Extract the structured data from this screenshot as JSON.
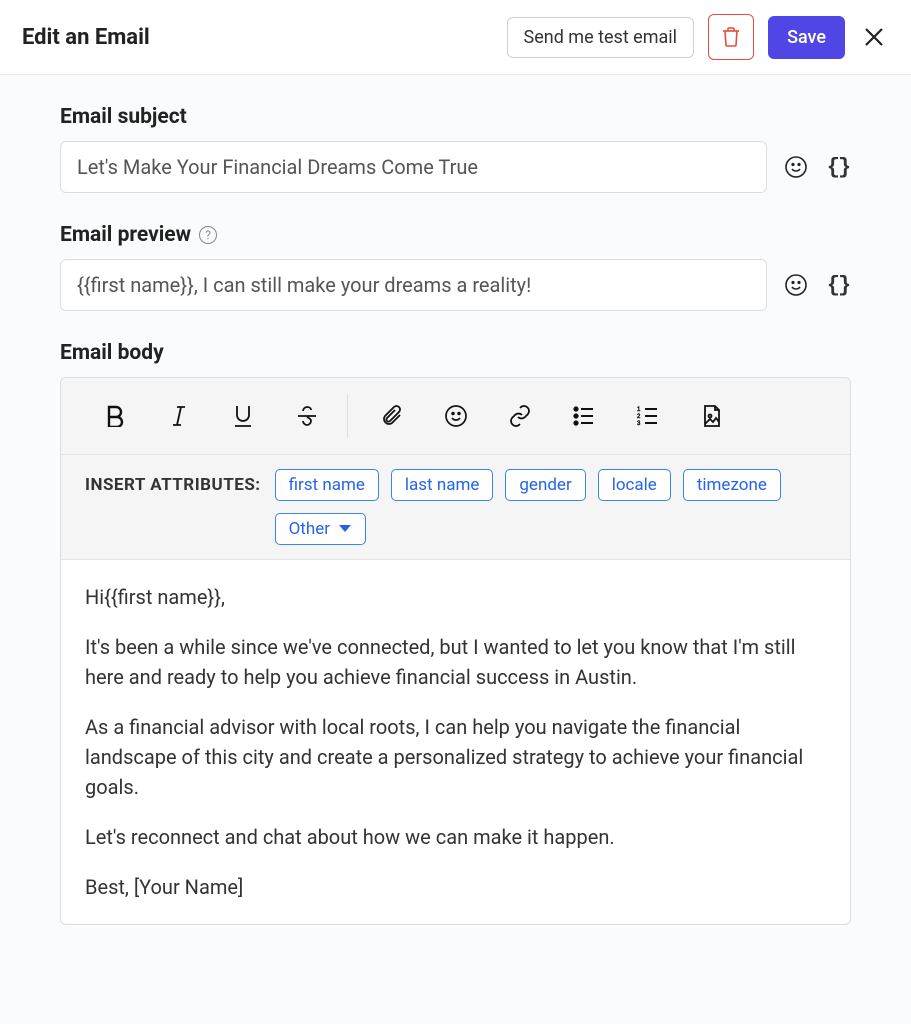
{
  "header": {
    "title": "Edit an Email",
    "test_label": "Send me test email",
    "save_label": "Save"
  },
  "subject": {
    "label": "Email subject",
    "value": "Let's Make Your Financial Dreams Come True"
  },
  "preview": {
    "label": "Email preview",
    "value": "{{first name}}, I can still make your dreams a reality!"
  },
  "body": {
    "label": "Email body",
    "attrs_label": "INSERT ATTRIBUTES:",
    "chips": [
      "first name",
      "last name",
      "gender",
      "locale",
      "timezone"
    ],
    "other_chip": "Other",
    "paragraphs": [
      "Hi{{first name}},",
      "It's been a while since we've connected, but I wanted to let you know that I'm still here and ready to help you achieve financial success in Austin.",
      "As a financial advisor with local roots, I can help you navigate the financial landscape of this city and create a personalized strategy to achieve your financial goals.",
      "Let's reconnect and chat about how we can make it happen.",
      "Best, [Your Name]"
    ]
  }
}
